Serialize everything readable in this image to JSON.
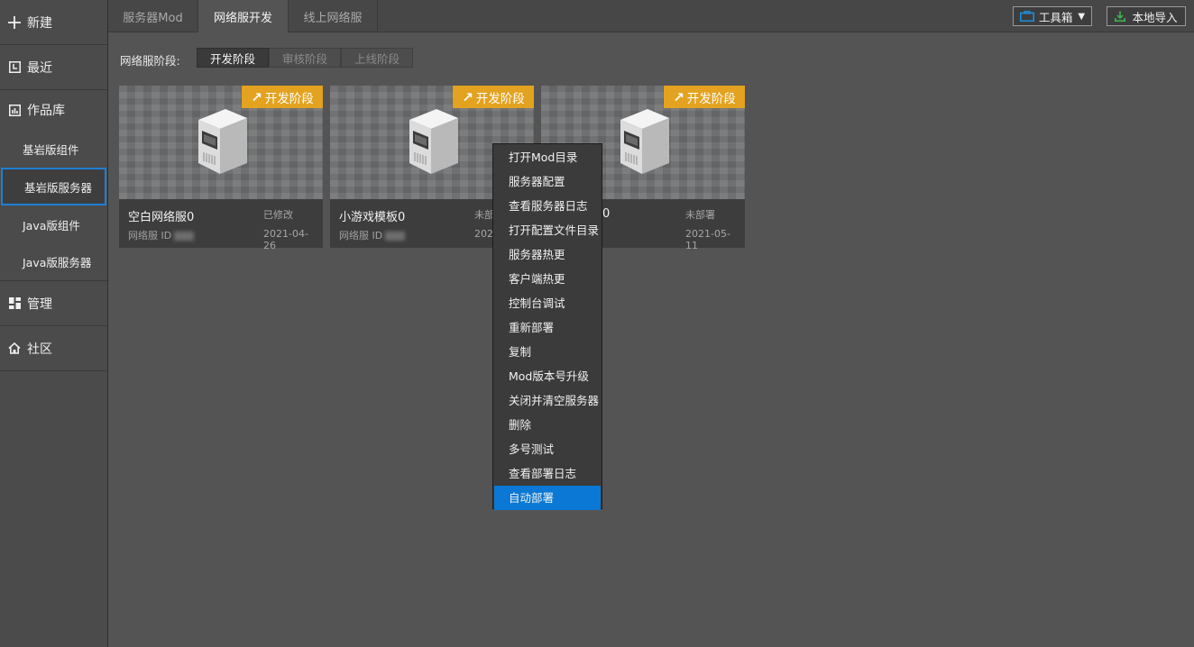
{
  "sidebar": {
    "new": "新建",
    "recent": "最近",
    "library": "作品库",
    "library_items": [
      "基岩版组件",
      "基岩版服务器",
      "Java版组件",
      "Java版服务器"
    ],
    "manage": "管理",
    "community": "社区"
  },
  "tabs": [
    "服务器Mod",
    "网络服开发",
    "线上网络服"
  ],
  "toolbar": {
    "toolbox": "工具箱",
    "local_import": "本地导入"
  },
  "stage": {
    "label": "网络服阶段:",
    "options": [
      "开发阶段",
      "审核阶段",
      "上线阶段"
    ]
  },
  "cards": [
    {
      "badge": "开发阶段",
      "name": "空白网络服0",
      "status": "已修改",
      "id_label": "网络服 ID",
      "date": "2021-04-26"
    },
    {
      "badge": "开发阶段",
      "name": "小游戏模板0",
      "status": "未部",
      "id_label": "网络服 ID",
      "date": "202"
    },
    {
      "badge": "开发阶段",
      "name": "0",
      "status": "未部署",
      "id_label": "",
      "date": "2021-05-11"
    }
  ],
  "context_menu": [
    "打开Mod目录",
    "服务器配置",
    "查看服务器日志",
    "打开配置文件目录",
    "服务器热更",
    "客户端热更",
    "控制台调试",
    "重新部署",
    "复制",
    "Mod版本号升级",
    "关闭并清空服务器",
    "删除",
    "多号测试",
    "查看部署日志",
    "自动部署"
  ],
  "colors": {
    "accent": "#0a78d4",
    "badge": "#e3a21f",
    "background": "#545454"
  }
}
